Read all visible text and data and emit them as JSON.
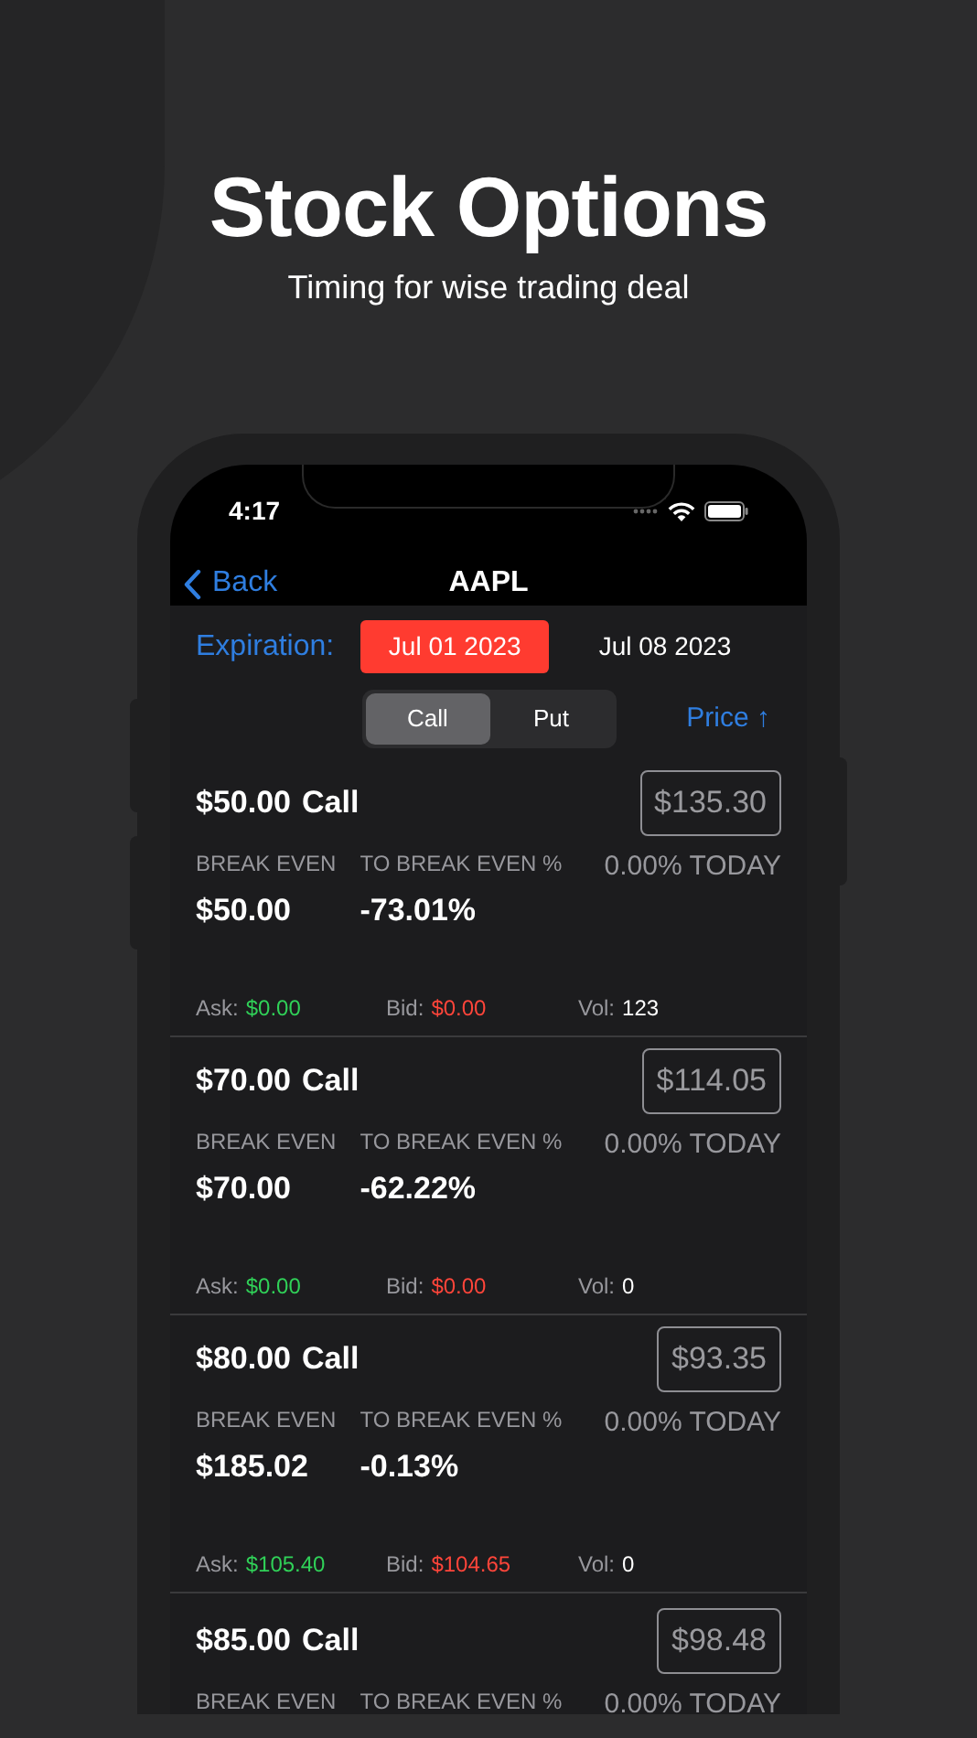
{
  "headline": {
    "title": "Stock Options",
    "subtitle": "Timing for wise trading deal"
  },
  "status_bar": {
    "time": "4:17"
  },
  "nav": {
    "back": "Back",
    "title": "AAPL"
  },
  "expiration": {
    "label": "Expiration:",
    "dates": [
      {
        "label": "Jul 01 2023",
        "selected": true
      },
      {
        "label": "Jul 08 2023",
        "selected": false
      }
    ]
  },
  "segments": [
    {
      "label": "Call",
      "selected": true
    },
    {
      "label": "Put",
      "selected": false
    }
  ],
  "sort": {
    "label": "Price ↑"
  },
  "options": [
    {
      "strike": "$50.00",
      "type": "Call",
      "price": "$135.30",
      "be_label": "BREAK EVEN",
      "be_value": "$50.00",
      "tbe_label": "TO BREAK EVEN %",
      "tbe_value": "-73.01%",
      "today": "0.00% TODAY",
      "ask_label": "Ask:",
      "ask": "$0.00",
      "bid_label": "Bid:",
      "bid": "$0.00",
      "vol_label": "Vol:",
      "vol": "123"
    },
    {
      "strike": "$70.00",
      "type": "Call",
      "price": "$114.05",
      "be_label": "BREAK EVEN",
      "be_value": "$70.00",
      "tbe_label": "TO BREAK EVEN %",
      "tbe_value": "-62.22%",
      "today": "0.00% TODAY",
      "ask_label": "Ask:",
      "ask": "$0.00",
      "bid_label": "Bid:",
      "bid": "$0.00",
      "vol_label": "Vol:",
      "vol": "0"
    },
    {
      "strike": "$80.00",
      "type": "Call",
      "price": "$93.35",
      "be_label": "BREAK EVEN",
      "be_value": "$185.02",
      "tbe_label": "TO BREAK EVEN %",
      "tbe_value": "-0.13%",
      "today": "0.00% TODAY",
      "ask_label": "Ask:",
      "ask": "$105.40",
      "bid_label": "Bid:",
      "bid": "$104.65",
      "vol_label": "Vol:",
      "vol": "0"
    },
    {
      "strike": "$85.00",
      "type": "Call",
      "price": "$98.48",
      "be_label": "BREAK EVEN",
      "tbe_label": "TO BREAK EVEN %",
      "today": "0.00% TODAY"
    }
  ]
}
